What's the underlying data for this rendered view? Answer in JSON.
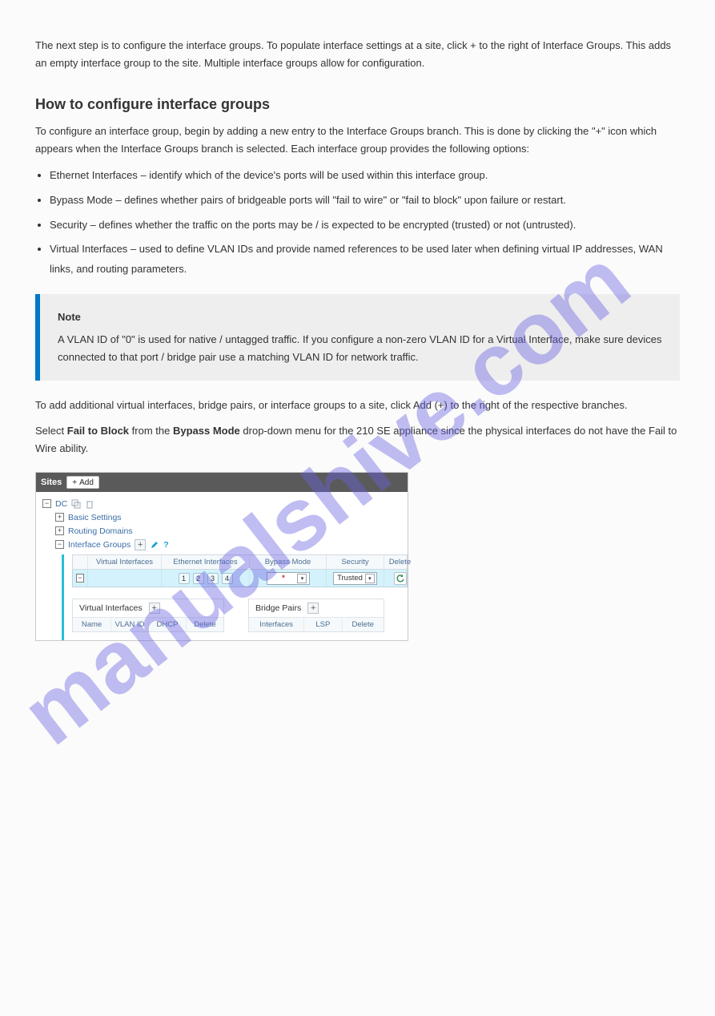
{
  "intro": "The next step is to configure the interface groups. To populate interface settings at a site, click + to the right of Interface Groups. This adds an empty interface group to the site. Multiple interface groups allow for configuration.",
  "section": {
    "heading": "How to configure interface groups",
    "desc": "To configure an interface group, begin by adding a new entry to the Interface Groups branch. This is done by clicking the \"+\" icon which appears when the Interface Groups branch is selected. Each interface group provides the following options:",
    "bullets": [
      "Ethernet Interfaces – identify which of the device's ports will be used within this interface group.",
      "Bypass Mode – defines whether pairs of bridgeable ports will \"fail to wire\" or \"fail to block\" upon failure or restart.",
      "Security – defines whether the traffic on the ports may be / is expected to be encrypted (trusted) or not (untrusted).",
      "Virtual Interfaces – used to define VLAN IDs and provide named references to be used later when defining virtual IP addresses, WAN links, and routing parameters."
    ],
    "p2": "To add additional virtual interfaces, bridge pairs, or interface groups to a site, click Add (+) to the right of the respective branches.",
    "p3_a": "Select ",
    "p3_b": "Fail to Block",
    "p3_c": " from the ",
    "p3_d": "Bypass Mode",
    "p3_e": " drop-down menu for the 210 SE appliance since the physical interfaces do not have the Fail to Wire ability."
  },
  "note": {
    "title": "Note",
    "body": "A VLAN ID of \"0\" is used for native / untagged traffic. If you configure a non-zero VLAN ID for a Virtual Interface, make sure devices connected to that port / bridge pair use a matching VLAN ID for network traffic."
  },
  "shot": {
    "bar_label": "Sites",
    "add_label": "Add",
    "tree": {
      "root": "DC",
      "n1": "Basic Settings",
      "n2": "Routing Domains",
      "n3": "Interface Groups"
    },
    "cols": [
      "Virtual Interfaces",
      "Ethernet Interfaces",
      "Bypass Mode",
      "Security",
      "Delete"
    ],
    "eth": [
      "1",
      "2",
      "3",
      "4"
    ],
    "security_value": "Trusted",
    "vi": {
      "title": "Virtual Interfaces",
      "cols": [
        "Name",
        "VLAN ID",
        "DHCP",
        "Delete"
      ]
    },
    "bp": {
      "title": "Bridge Pairs",
      "cols": [
        "Interfaces",
        "LSP",
        "Delete"
      ]
    }
  }
}
